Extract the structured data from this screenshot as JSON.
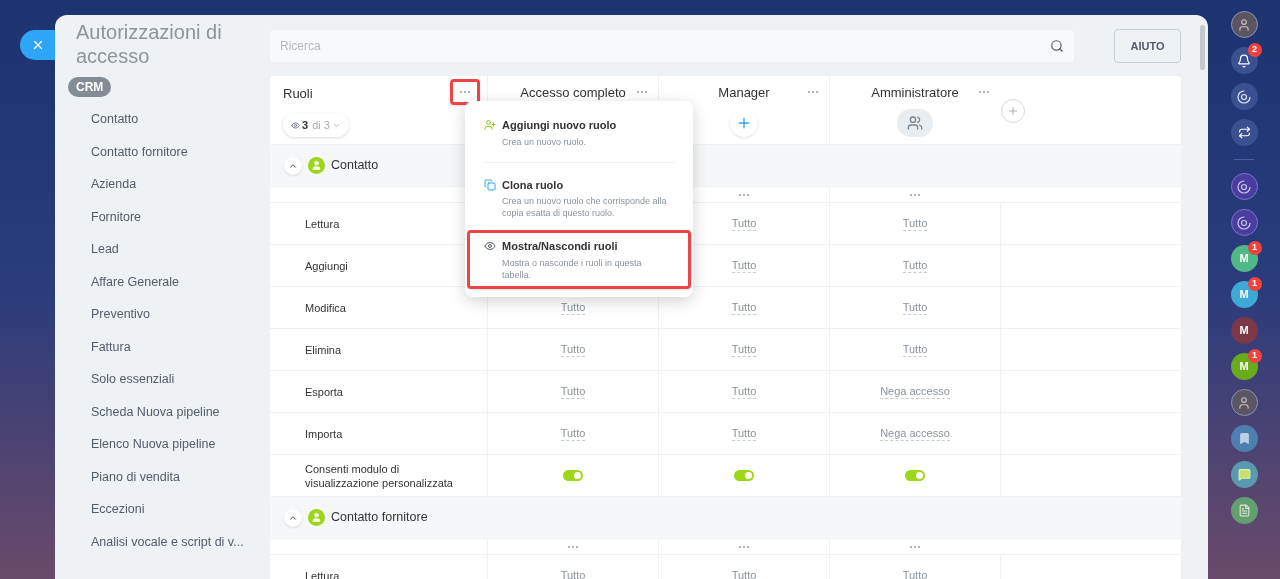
{
  "window": {
    "title": "Autorizzazioni di accesso"
  },
  "search": {
    "placeholder": "Ricerca"
  },
  "help_button": "AIUTO",
  "sidebar": {
    "badge": "CRM",
    "items": [
      {
        "label": "Contatto"
      },
      {
        "label": "Contatto fornitore"
      },
      {
        "label": "Azienda"
      },
      {
        "label": "Fornitore"
      },
      {
        "label": "Lead"
      },
      {
        "label": "Affare Generale"
      },
      {
        "label": "Preventivo"
      },
      {
        "label": "Fattura"
      },
      {
        "label": "Solo essenziali"
      },
      {
        "label": "Scheda Nuova pipeline"
      },
      {
        "label": "Elenco Nuova pipeline"
      },
      {
        "label": "Piano di vendita"
      },
      {
        "label": "Eccezioni"
      },
      {
        "label": "Analisi vocale e script di v..."
      }
    ]
  },
  "table": {
    "roles_label": "Ruoli",
    "menu_button_highlighted": true,
    "filter": {
      "count": "3",
      "total": "di 3"
    },
    "columns": [
      {
        "title": "Accesso completo",
        "kind": "none"
      },
      {
        "title": "Manager",
        "kind": "add"
      },
      {
        "title": "Amministratore",
        "kind": "users"
      }
    ],
    "sections": [
      {
        "title": "Contatto",
        "expanded": true,
        "rows": [
          {
            "label": "Lettura",
            "kind": "text",
            "first_covered": true,
            "values": [
              "Tutto",
              "Tutto"
            ]
          },
          {
            "label": "Aggiungi",
            "kind": "text",
            "first_covered": true,
            "values": [
              "Tutto",
              "Tutto"
            ]
          },
          {
            "label": "Modifica",
            "kind": "text",
            "values": [
              "Tutto",
              "Tutto",
              "Tutto"
            ]
          },
          {
            "label": "Elimina",
            "kind": "text",
            "values": [
              "Tutto",
              "Tutto",
              "Tutto"
            ]
          },
          {
            "label": "Esporta",
            "kind": "text",
            "values": [
              "Tutto",
              "Tutto",
              "Nega accesso"
            ]
          },
          {
            "label": "Importa",
            "kind": "text",
            "values": [
              "Tutto",
              "Tutto",
              "Nega accesso"
            ]
          },
          {
            "label": "Consenti modulo di visualizzazione personalizzata",
            "kind": "toggle",
            "values": [
              true,
              true,
              true
            ]
          }
        ]
      },
      {
        "title": "Contatto fornitore",
        "expanded": true,
        "rows": [
          {
            "label": "Lettura",
            "kind": "text",
            "values": [
              "Tutto",
              "Tutto",
              "Tutto"
            ]
          }
        ]
      }
    ]
  },
  "menu": {
    "items": [
      {
        "kind": "add",
        "title": "Aggiungi nuovo ruolo",
        "description": "Crea un nuovo ruolo.",
        "highlighted": false
      },
      {
        "kind": "clone",
        "title": "Clona ruolo",
        "description": "Crea un nuovo ruolo che corrisponde alla copia esatta di questo ruolo.",
        "highlighted": false
      },
      {
        "kind": "eye",
        "title": "Mostra/Nascondi ruoli",
        "description": "Mostra o nasconde i ruoli in questa tabella.",
        "highlighted": true
      }
    ]
  },
  "rail": {
    "items": [
      {
        "kind": "photo"
      },
      {
        "kind": "bell",
        "badge": "2"
      },
      {
        "kind": "swirl"
      },
      {
        "kind": "chat"
      },
      {
        "kind": "divider"
      },
      {
        "kind": "swirl-violet"
      },
      {
        "kind": "swirl-violet"
      },
      {
        "kind": "letter",
        "letter": "M",
        "color": "#4fb886",
        "badge": "1"
      },
      {
        "kind": "letter",
        "letter": "M",
        "color": "#3fa9d6",
        "badge": "1"
      },
      {
        "kind": "letter",
        "letter": "M",
        "color": "#7a3848"
      },
      {
        "kind": "letter",
        "letter": "M",
        "color": "#6aab1c",
        "badge": "1"
      },
      {
        "kind": "photo"
      },
      {
        "kind": "bookmark"
      },
      {
        "kind": "messages"
      },
      {
        "kind": "notes"
      }
    ]
  }
}
